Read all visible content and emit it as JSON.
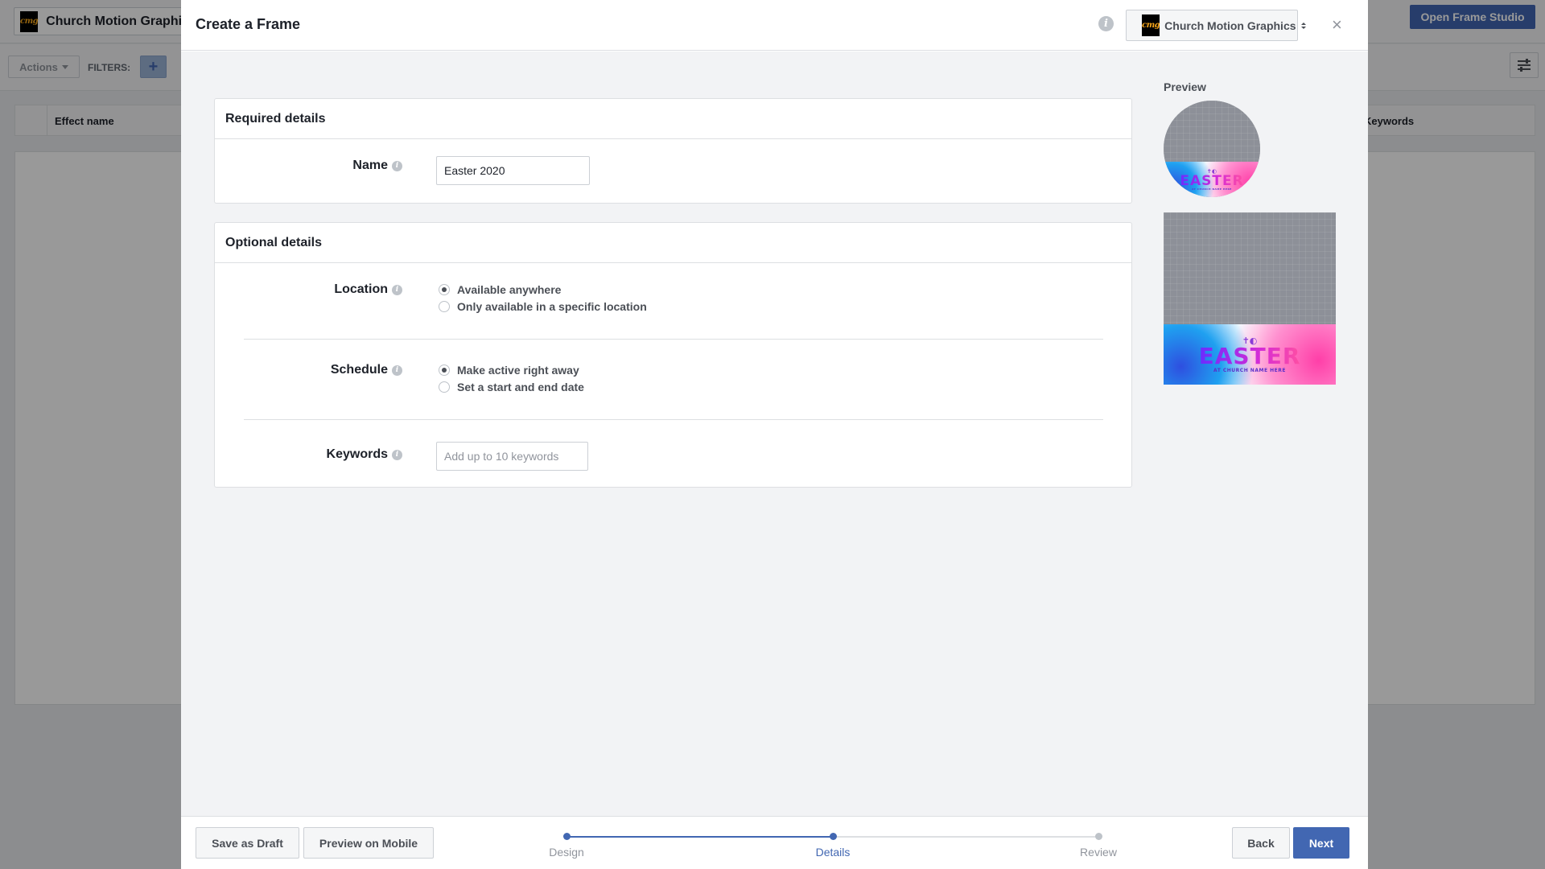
{
  "background": {
    "page_selector": {
      "label": "Church Motion Graphics",
      "logo_text": "cmg"
    },
    "open_studio_label": "Open Frame Studio",
    "actions_label": "Actions",
    "filters_label": "FILTERS:",
    "add_filter_symbol": "+",
    "table_headers": {
      "effect_name": "Effect name",
      "keywords": "Keywords"
    }
  },
  "dialog": {
    "title": "Create a Frame",
    "info_symbol": "i",
    "page_selector": {
      "label": "Church Motion Graphics",
      "logo_text": "cmg"
    },
    "close_symbol": "×",
    "required": {
      "heading": "Required details",
      "name_label": "Name",
      "name_value": "Easter 2020"
    },
    "optional": {
      "heading": "Optional details",
      "location": {
        "label": "Location",
        "options": [
          "Available anywhere",
          "Only available in a specific location"
        ],
        "selected": 0
      },
      "schedule": {
        "label": "Schedule",
        "options": [
          "Make active right away",
          "Set a start and end date"
        ],
        "selected": 0
      },
      "keywords": {
        "label": "Keywords",
        "placeholder": "Add up to 10 keywords"
      }
    },
    "help_symbol": "i",
    "preview": {
      "label": "Preview",
      "frame_title": "EASTER",
      "frame_subtitle": "AT CHURCH NAME HERE",
      "frame_glyphs": "✝◐"
    },
    "footer": {
      "save_draft": "Save as Draft",
      "preview_mobile": "Preview on Mobile",
      "steps": [
        "Design",
        "Details",
        "Review"
      ],
      "current_step": 1,
      "back": "Back",
      "next": "Next"
    }
  },
  "colors": {
    "accent": "#4267b2",
    "step_active": "#4267b2",
    "step_inactive": "#bec3c9"
  }
}
